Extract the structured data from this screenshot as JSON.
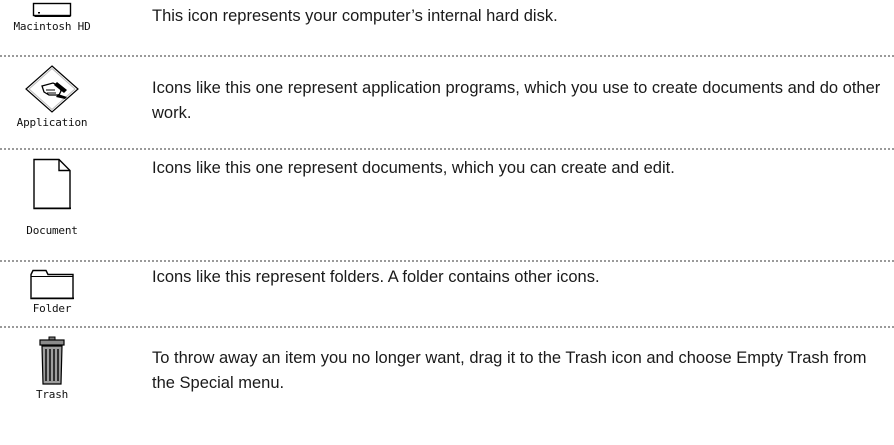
{
  "items": [
    {
      "icon": "hard-disk-icon",
      "label": "Macintosh HD",
      "description": "This icon represents your computer’s internal hard disk."
    },
    {
      "icon": "application-icon",
      "label": "Application",
      "description": "Icons like this one represent application programs, which you use to create documents and do other work."
    },
    {
      "icon": "document-icon",
      "label": "Document",
      "description": "Icons like this one represent documents, which you can create and edit."
    },
    {
      "icon": "folder-icon",
      "label": "Folder",
      "description": "Icons like this represent folders. A folder contains other icons."
    },
    {
      "icon": "trash-icon",
      "label": "Trash",
      "description": "To throw away an item you no longer want, drag it to the Trash icon and choose Empty Trash from the Special menu."
    }
  ]
}
